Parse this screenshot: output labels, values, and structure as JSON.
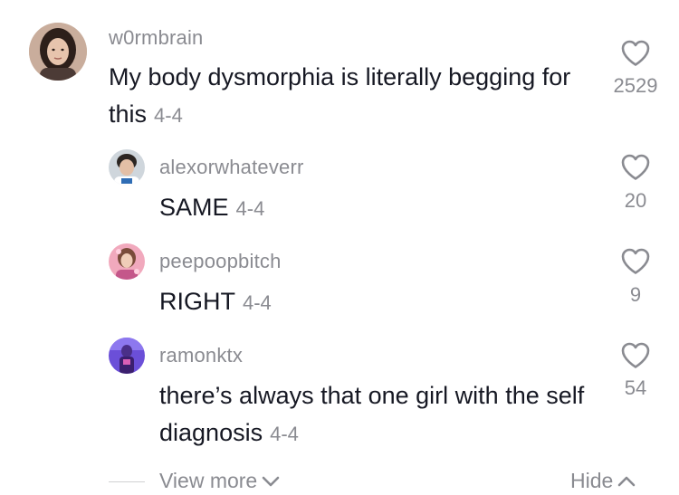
{
  "main_comment": {
    "username": "w0rmbrain",
    "text": "My body dysmorphia is literally begging for this",
    "date": "4-4",
    "likes": "2529",
    "avatar_icon": "user-avatar-photo"
  },
  "replies": [
    {
      "username": "alexorwhateverr",
      "text": "SAME",
      "date": "4-4",
      "likes": "20"
    },
    {
      "username": "peepoopbitch",
      "text": "RIGHT",
      "date": "4-4",
      "likes": "9"
    },
    {
      "username": "ramonktx",
      "text": "there’s always that one girl with the self diagnosis",
      "date": "4-4",
      "likes": "54"
    }
  ],
  "footer": {
    "view_more_label": "View more",
    "hide_label": "Hide"
  },
  "colors": {
    "primary_text": "#161823",
    "secondary_text": "#8a8b91",
    "heart_stroke": "#8a8b91"
  },
  "icons": {
    "like": "heart-outline-icon",
    "expand": "chevron-down-icon",
    "collapse": "chevron-up-icon"
  }
}
